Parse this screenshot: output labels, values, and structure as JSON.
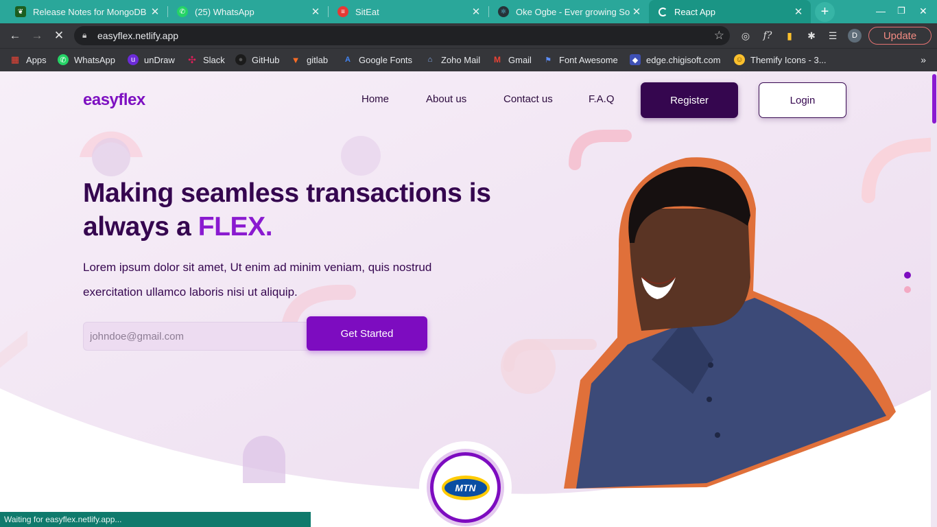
{
  "browser": {
    "tabs": [
      {
        "title": "Release Notes for MongoDB",
        "icon": "mongodb-leaf-icon",
        "active": false
      },
      {
        "title": "(25) WhatsApp",
        "icon": "whatsapp-icon",
        "active": false
      },
      {
        "title": "SitEat",
        "icon": "siteat-icon",
        "active": false
      },
      {
        "title": "Oke Ogbe - Ever growing So",
        "icon": "react-icon",
        "active": false
      },
      {
        "title": "React App",
        "icon": "loading-spinner-icon",
        "active": true
      }
    ],
    "url": "easyflex.netlify.app",
    "profile_initial": "D",
    "update_label": "Update",
    "bookmarks": [
      {
        "label": "Apps",
        "icon": "apps-grid-icon"
      },
      {
        "label": "WhatsApp",
        "icon": "whatsapp-icon"
      },
      {
        "label": "unDraw",
        "icon": "undraw-icon"
      },
      {
        "label": "Slack",
        "icon": "slack-icon"
      },
      {
        "label": "GitHub",
        "icon": "github-icon"
      },
      {
        "label": "gitlab",
        "icon": "gitlab-icon"
      },
      {
        "label": "Google Fonts",
        "icon": "google-fonts-icon"
      },
      {
        "label": "Zoho Mail",
        "icon": "zoho-mail-icon"
      },
      {
        "label": "Gmail",
        "icon": "gmail-icon"
      },
      {
        "label": "Font Awesome",
        "icon": "font-awesome-flag-icon"
      },
      {
        "label": "edge.chigisoft.com",
        "icon": "edge-chigisoft-icon"
      },
      {
        "label": "Themify Icons - 3...",
        "icon": "themify-icon"
      }
    ],
    "status_text": "Waiting for easyflex.netlify.app..."
  },
  "site": {
    "logo": "easyflex",
    "nav": [
      "Home",
      "About us",
      "Contact us",
      "F.A.Q"
    ],
    "register_label": "Register",
    "login_label": "Login",
    "headline_main": "Making seamless transactions is always a ",
    "headline_accent": "FLEX.",
    "lede": "Lorem ipsum dolor sit amet, Ut enim ad minim veniam, quis nostrud exercitation ullamco laboris nisi ut aliquip.",
    "email_placeholder": "johndoe@gmail.com",
    "cta_label": "Get Started",
    "partner_logo_text": "MTN",
    "slider_dots": 2,
    "slider_active_index": 0
  },
  "colors": {
    "tabbar": "#2aa79a",
    "brand_purple": "#7d0cc0",
    "dark_purple": "#35064f",
    "hero_bg": "#f2e8f4",
    "accent_pink": "#f7c6d3",
    "portrait_outline": "#e0703a"
  }
}
